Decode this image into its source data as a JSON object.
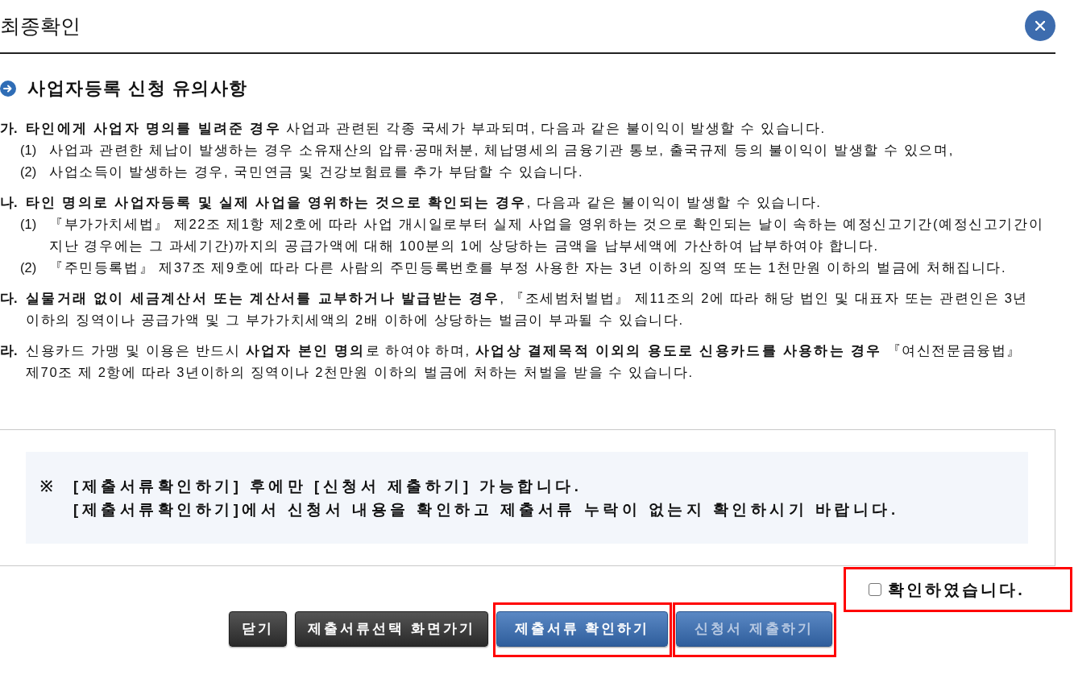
{
  "dialog": {
    "title": "최종확인"
  },
  "notice_section": {
    "heading": "사업자등록 신청 유의사항",
    "items": [
      {
        "marker": "가.",
        "text": "**타인에게 사업자 명의를 빌려준 경우** 사업과 관련된 각종 국세가 부과되며, 다음과 같은 불이익이 발생할 수 있습니다.",
        "children": [
          {
            "marker": "(1)",
            "text": "사업과 관련한 체납이 발생하는 경우 소유재산의 압류·공매처분, 체납명세의 금융기관 통보, 출국규제 등의 불이익이 발생할 수 있으며,"
          },
          {
            "marker": "(2)",
            "text": "사업소득이 발생하는 경우, 국민연금 및 건강보험료를 추가 부담할 수 있습니다."
          }
        ]
      },
      {
        "marker": "나.",
        "text": "**타인 명의로 사업자등록 및 실제 사업을 영위하는 것으로 확인되는 경우**, 다음과 같은 불이익이 발생할 수 있습니다.",
        "children": [
          {
            "marker": "(1)",
            "text": "『부가가치세법』 제22조 제1항 제2호에 따라 사업 개시일로부터 실제 사업을 영위하는 것으로 확인되는 날이 속하는 예정신고기간(예정신고기간이 지난 경우에는 그 과세기간)까지의 공급가액에 대해 100분의 1에 상당하는 금액을 납부세액에 가산하여 납부하여야 합니다."
          },
          {
            "marker": "(2)",
            "text": "『주민등록법』 제37조 제9호에 따라 다른 사람의 주민등록번호를 부정 사용한 자는 3년 이하의 징역 또는 1천만원 이하의 벌금에 처해집니다."
          }
        ]
      },
      {
        "marker": "다.",
        "text": "**실물거래 없이 세금계산서 또는 계산서를 교부하거나 발급받는 경우**, 『조세범처벌법』 제11조의 2에 따라 해당 법인 및 대표자 또는 관련인은 3년 이하의 징역이나 공급가액 및 그 부가가치세액의 2배 이하에 상당하는 벌금이 부과될 수 있습니다."
      },
      {
        "marker": "라.",
        "text": "신용카드 가맹 및 이용은 반드시 **사업자 본인 명의**로 하여야 하며, **사업상 결제목적 이외의 용도로 신용카드를 사용하는 경우** 『여신전문금융법』 제70조 제 2항에 따라 3년이하의 징역이나 2천만원 이하의 벌금에 처하는 처벌을 받을 수 있습니다."
      }
    ]
  },
  "info_box": {
    "mark": "※",
    "lines": [
      "[제출서류확인하기] 후에만 [신청서 제출하기] 가능합니다.",
      "[제출서류확인하기]에서 신청서 내용을 확인하고 제출서류 누락이 없는지 확인하시기 바랍니다."
    ]
  },
  "buttons": [
    {
      "label": "닫기",
      "kind": "dark",
      "disabled": false,
      "highlighted": false
    },
    {
      "label": "제출서류선택 화면가기",
      "kind": "dark",
      "disabled": false,
      "highlighted": false
    },
    {
      "label": "제출서류 확인하기",
      "kind": "primary",
      "disabled": false,
      "highlighted": true
    },
    {
      "label": "신청서 제출하기",
      "kind": "primary",
      "disabled": true,
      "highlighted": true
    }
  ],
  "confirm_checkbox": {
    "label": "확인하였습니다.",
    "checked": false,
    "highlighted": true
  }
}
